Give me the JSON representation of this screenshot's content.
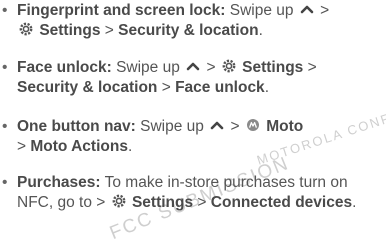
{
  "watermark": {
    "line1": "MOTOROLA CONFIDENTIAL",
    "line2": "FCC SUBMISSION"
  },
  "items": [
    {
      "title": "Fingerprint and screen lock:",
      "pre": "Swipe up",
      "sep1": ">",
      "settings": "Settings",
      "sep2": ">",
      "target": "Security & location",
      "end": "."
    },
    {
      "title": "Face unlock:",
      "pre": "Swipe up",
      "sep1": ">",
      "settings": "Settings",
      "sep2": ">",
      "target1": "Security & location",
      "sep3": ">",
      "target2": "Face unlock",
      "end": "."
    },
    {
      "title": "One button nav:",
      "pre": "Swipe up",
      "sep1": ">",
      "app": "Moto",
      "sep2": ">",
      "target": "Moto Actions",
      "end": "."
    },
    {
      "title": "Purchases:",
      "pre": "To make in-store purchases turn on NFC, go to",
      "sep1": ">",
      "settings": "Settings",
      "sep2": ">",
      "target": "Connected devices",
      "end": "."
    }
  ],
  "icons": {
    "caret": "caret-up-icon",
    "gear": "settings-gear-icon",
    "moto": "moto-app-icon"
  }
}
